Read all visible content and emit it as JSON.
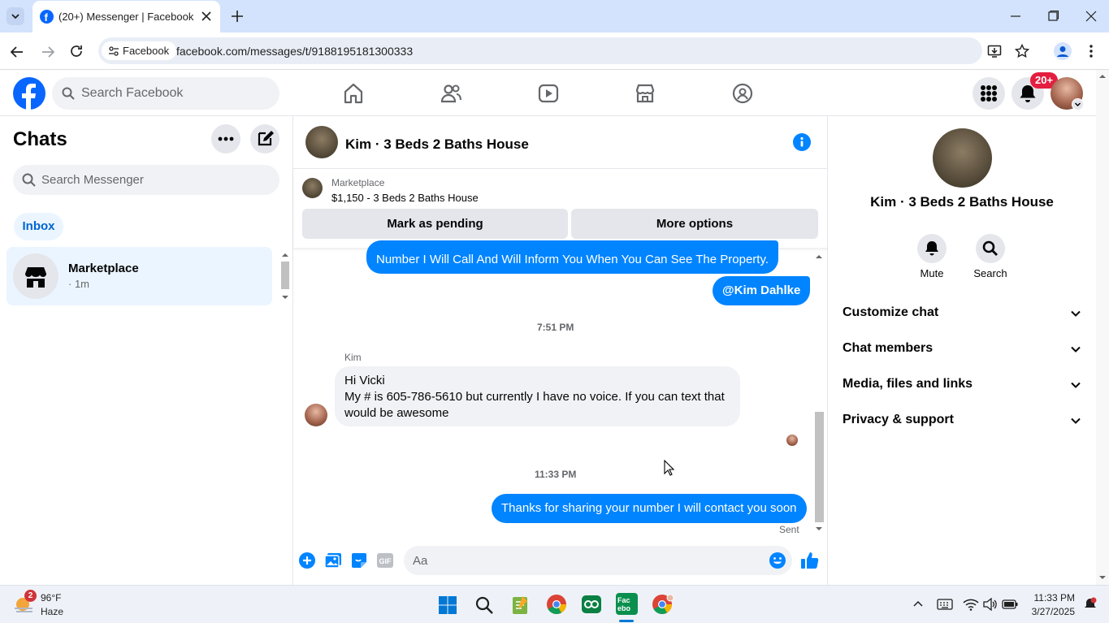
{
  "browser": {
    "tab_title": "(20+) Messenger | Facebook",
    "site_chip": "Facebook",
    "url": "facebook.com/messages/t/9188195181300333"
  },
  "header": {
    "search_placeholder": "Search Facebook",
    "notif_badge": "20+"
  },
  "sidebar": {
    "title": "Chats",
    "search_placeholder": "Search Messenger",
    "inbox_label": "Inbox",
    "conversations": [
      {
        "name": "Marketplace",
        "meta": "· 1m"
      }
    ]
  },
  "chat": {
    "title": "Kim · 3 Beds 2 Baths House",
    "listing_source": "Marketplace",
    "listing_title": "$1,150 - 3 Beds 2 Baths House",
    "mark_pending_label": "Mark as pending",
    "more_options_label": "More options",
    "messages": {
      "out1": "Number I Will Call And Will Inform You When You Can See The Property.",
      "out2": "@Kim Dahlke",
      "time1": "7:51 PM",
      "sender": "Kim",
      "in1_line1": "Hi Vicki",
      "in1_line2": "My # is 605-786-5610 but currently I have no voice.  If you can text that would be awesome",
      "time2": "11:33 PM",
      "out3": "Thanks for sharing your number I will contact you soon",
      "status": "Sent"
    },
    "composer_placeholder": "Aa"
  },
  "info_panel": {
    "name": "Kim · 3 Beds 2 Baths House",
    "mute_label": "Mute",
    "search_label": "Search",
    "sections": [
      "Customize chat",
      "Chat members",
      "Media, files and links",
      "Privacy & support"
    ]
  },
  "taskbar": {
    "weather_temp": "96°F",
    "weather_desc": "Haze",
    "weather_badge": "2",
    "time": "11:33 PM",
    "date": "3/27/2025"
  },
  "colors": {
    "messenger_blue": "#0084ff",
    "fb_blue": "#0866ff",
    "notif_red": "#e41e3f"
  }
}
